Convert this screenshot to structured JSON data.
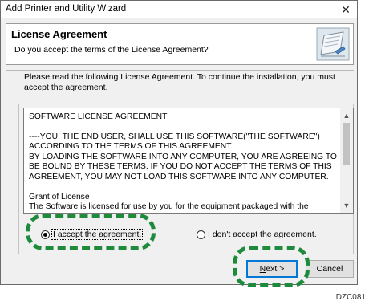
{
  "window": {
    "title": "Add Printer and Utility Wizard",
    "close_glyph": "✕"
  },
  "header": {
    "title": "License Agreement",
    "subtitle": "Do you accept the terms of the License Agreement?",
    "icon": "document-icon"
  },
  "intro": "Please read the following License Agreement. To continue the installation, you must accept the agreement.",
  "license": {
    "heading": "SOFTWARE LICENSE AGREEMENT",
    "paragraph1": "----YOU, THE END USER, SHALL USE THIS SOFTWARE(\"THE SOFTWARE\") ACCORDING TO THE TERMS OF THIS AGREEMENT.\nBY LOADING THE SOFTWARE INTO ANY COMPUTER, YOU ARE AGREEING TO BE BOUND BY THESE TERMS. IF YOU DO NOT ACCEPT THE TERMS OF THIS AGREEMENT, YOU MAY NOT LOAD THIS SOFTWARE INTO ANY COMPUTER.",
    "grant_title": "Grant of License",
    "grant_text": "The Software is licensed for use by you for the equipment packaged with the Software"
  },
  "options": {
    "accept_label_underlined": "I",
    "accept_label_rest": " accept the agreement.",
    "accept_selected": true,
    "decline_label_underlined": "I",
    "decline_label_rest": " don't accept the agreement.",
    "decline_selected": false
  },
  "buttons": {
    "next_underlined": "N",
    "next_rest": "ext >",
    "cancel": "Cancel"
  },
  "figure_code": "DZC081",
  "colors": {
    "highlight": "#1d8a3c",
    "default_button_border": "#0078d7"
  }
}
